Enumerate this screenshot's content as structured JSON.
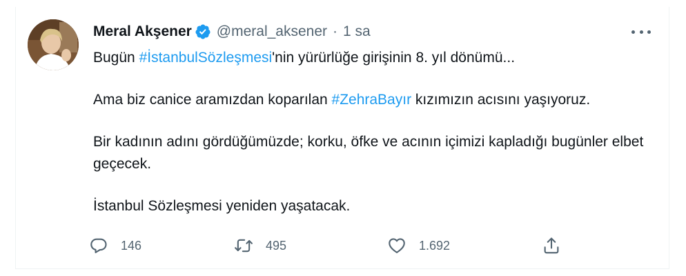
{
  "tweet": {
    "author": {
      "name": "Meral Akşener",
      "handle": "@meral_aksener",
      "verified": true
    },
    "separator": "·",
    "time": "1 sa",
    "body": {
      "p1_prefix": "Bugün ",
      "p1_hashtag": "#İstanbulSözleşmesi",
      "p1_suffix": "'nin yürürlüğe girişinin 8. yıl dönümü...",
      "p2_prefix": "Ama biz canice aramızdan koparılan ",
      "p2_hashtag": "#ZehraBayır",
      "p2_suffix": " kızımızın acısını yaşıyoruz.",
      "p3": "Bir kadının adını gördüğümüzde; korku, öfke ve acının içimizi kapladığı bugünler elbet geçecek.",
      "p4": "İstanbul Sözleşmesi yeniden yaşatacak."
    },
    "actions": {
      "reply_count": "146",
      "retweet_count": "495",
      "like_count": "1.692"
    }
  },
  "icons": {
    "verified": "verified-badge-icon",
    "more": "more-horizontal-icon",
    "reply": "reply-icon",
    "retweet": "retweet-icon",
    "like": "heart-icon",
    "share": "share-icon"
  },
  "colors": {
    "accent": "#1d9bf0",
    "text": "#0f1419",
    "muted": "#536471",
    "border": "#eff3f4"
  }
}
